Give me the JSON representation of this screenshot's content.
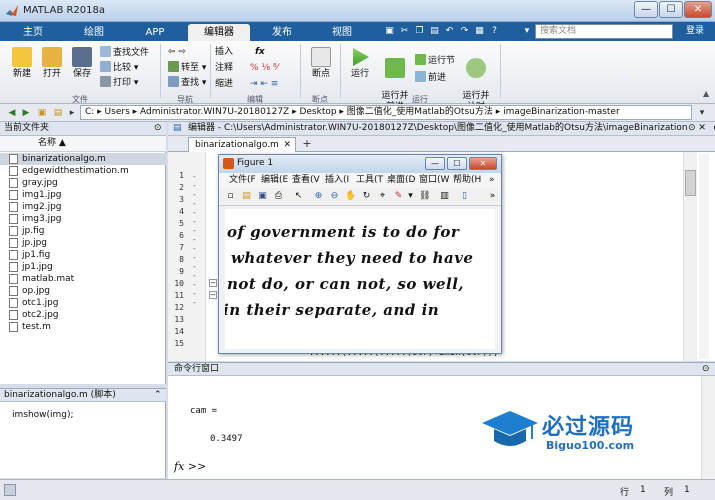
{
  "window": {
    "title": "MATLAB R2018a",
    "min": "—",
    "max": "☐",
    "close": "✕"
  },
  "tabs": [
    {
      "label": "主页",
      "active": false
    },
    {
      "label": "绘图",
      "active": false
    },
    {
      "label": "APP",
      "active": false
    },
    {
      "label": "编辑器",
      "active": true
    },
    {
      "label": "发布",
      "active": false
    },
    {
      "label": "视图",
      "active": false
    }
  ],
  "search": {
    "placeholder": "搜索文档",
    "login": "登录"
  },
  "ribbon": {
    "file": {
      "new": "新建",
      "open": "打开",
      "save": "保存",
      "find_files": "查找文件",
      "compare": "比较",
      "print": "打印",
      "group": "文件"
    },
    "navigate": {
      "goto": "转至",
      "find": "查找",
      "group": "导航"
    },
    "edit": {
      "insert": "插入",
      "comment": "注释",
      "indent": "缩进",
      "fx": "fx",
      "group": "编辑"
    },
    "breakpoints": {
      "label": "断点",
      "group": "断点"
    },
    "run": {
      "run": "运行",
      "run_advance": "运行并\n前进",
      "run_section": "运行节",
      "advance": "前进",
      "run_time": "运行并\n计时",
      "group": "运行"
    }
  },
  "address": {
    "path": "C: ▸ Users ▸ Administrator.WIN7U-20180127Z ▸ Desktop ▸ 图像二值化_使用Matlab的Otsu方法 ▸ imageBinarization-master"
  },
  "current_folder": {
    "title": "当前文件夹",
    "column": "名称 ▲",
    "files": [
      {
        "name": "binarizationalgo.m",
        "selected": true
      },
      {
        "name": "edgewidthestimation.m",
        "selected": false
      },
      {
        "name": "gray.jpg",
        "selected": false
      },
      {
        "name": "img1.jpg",
        "selected": false
      },
      {
        "name": "img2.jpg",
        "selected": false
      },
      {
        "name": "img3.jpg",
        "selected": false
      },
      {
        "name": "jp.fig",
        "selected": false
      },
      {
        "name": "jp.jpg",
        "selected": false
      },
      {
        "name": "jp1.fig",
        "selected": false
      },
      {
        "name": "jp1.jpg",
        "selected": false
      },
      {
        "name": "matlab.mat",
        "selected": false
      },
      {
        "name": "op.jpg",
        "selected": false
      },
      {
        "name": "otc1.jpg",
        "selected": false
      },
      {
        "name": "otc2.jpg",
        "selected": false
      },
      {
        "name": "test.m",
        "selected": false
      }
    ]
  },
  "details": {
    "title": "binarizationalgo.m  (脚本)",
    "content": "imshow(img);"
  },
  "editor": {
    "title": "编辑器 - C:\\Users\\Administrator.WIN7U-20180127Z\\Desktop\\图像二值化_使用Matlab的Otsu方法\\imageBinarization-master\\binarizationalgo.m",
    "tab": "binarizationalgo.m",
    "plus": "+",
    "line_numbers": [
      "1",
      "2",
      "3",
      "4",
      "5",
      "6",
      "7",
      "8",
      "9",
      "10",
      "11",
      "12",
      "13",
      "14",
      "15"
    ],
    "visible_code": "= ......(.....(.....(ctr)+imin(ctr));"
  },
  "command_window": {
    "title": "命令行窗口",
    "line1": "cam =",
    "line2": "0.3497",
    "prompt": "fx >>"
  },
  "status": {
    "row_label": "行",
    "row": "1",
    "col_label": "列",
    "col": "1"
  },
  "figure": {
    "title": "Figure 1",
    "menu": [
      "文件(F",
      "编辑(E",
      "查看(V",
      "插入(I",
      "工具(T",
      "桌面(D",
      "窗口(W",
      "帮助(H"
    ],
    "image_text": [
      "of government is to do for",
      "whatever they need to have",
      "not do, or can not, so well,",
      "in their separate, and in"
    ]
  },
  "watermark": {
    "text": "必过源码",
    "url": "Biguo100.com"
  }
}
